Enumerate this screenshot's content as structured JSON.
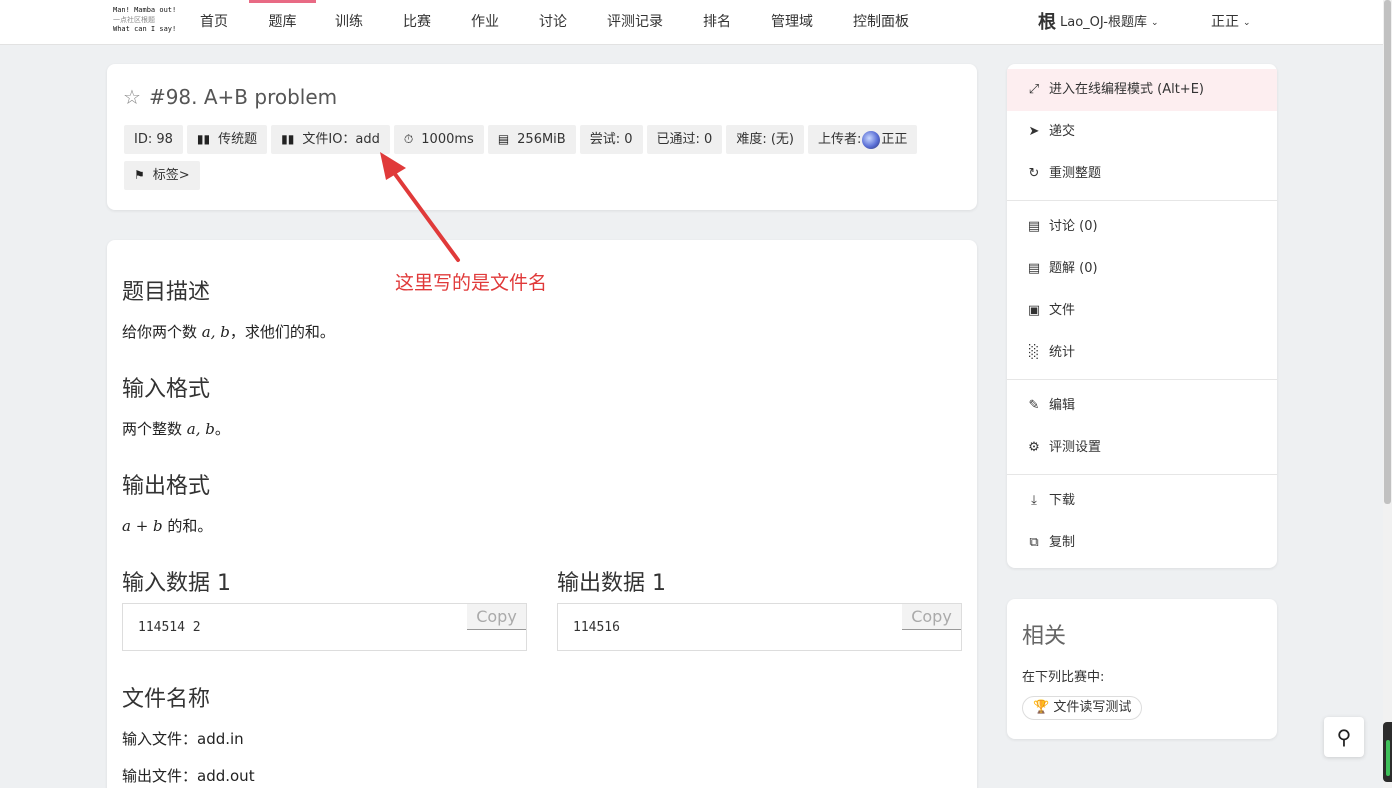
{
  "logo": {
    "line1": "Man! Mamba out!",
    "line2": "一点社区根题",
    "line3": "What can I say!"
  },
  "nav": [
    {
      "label": "首页",
      "active": false
    },
    {
      "label": "题库",
      "active": true
    },
    {
      "label": "训练",
      "active": false
    },
    {
      "label": "比赛",
      "active": false
    },
    {
      "label": "作业",
      "active": false
    },
    {
      "label": "讨论",
      "active": false
    },
    {
      "label": "评测记录",
      "active": false
    },
    {
      "label": "排名",
      "active": false
    },
    {
      "label": "管理域",
      "active": false
    },
    {
      "label": "控制面板",
      "active": false
    }
  ],
  "site_switch": {
    "glyph": "根",
    "label": "Lao_OJ-根题库"
  },
  "user": {
    "name": "正正"
  },
  "problem": {
    "title": "#98. A+B problem",
    "meta": {
      "id": "ID: 98",
      "type": "传统题",
      "file_io": "文件IO：add",
      "time_limit": "1000ms",
      "memory": "256MiB",
      "tried": "尝试: 0",
      "passed": "已通过: 0",
      "difficulty": "难度: (无)",
      "uploader_label": "上传者:",
      "uploader": "正正"
    },
    "tags_button": "标签>"
  },
  "annotation": "这里写的是文件名",
  "content": {
    "desc_title": "题目描述",
    "desc_pre": "给你两个数 ",
    "desc_math": "a, b",
    "desc_post": "，求他们的和。",
    "input_title": "输入格式",
    "input_pre": "两个整数 ",
    "input_math": "a, b",
    "input_post": "。",
    "output_title": "输出格式",
    "output_math": "a + b",
    "output_post": " 的和。",
    "sample_in_title": "输入数据 1",
    "sample_in": "114514 2",
    "sample_out_title": "输出数据 1",
    "sample_out": "114516",
    "copy_label": "Copy",
    "file_title": "文件名称",
    "input_file": "输入文件：add.in",
    "output_file": "输出文件：add.out"
  },
  "sidebar": {
    "items": [
      {
        "label": "进入在线编程模式 (Alt+E)",
        "icon": "expand-icon"
      },
      {
        "label": "递交",
        "icon": "send-icon"
      },
      {
        "label": "重测整题",
        "icon": "refresh-icon"
      },
      {
        "label": "讨论 (0)",
        "icon": "comment-icon"
      },
      {
        "label": "题解 (0)",
        "icon": "comment-icon"
      },
      {
        "label": "文件",
        "icon": "image-file-icon"
      },
      {
        "label": "统计",
        "icon": "bar-chart-icon"
      },
      {
        "label": "编辑",
        "icon": "pencil-icon"
      },
      {
        "label": "评测设置",
        "icon": "gear-icon"
      },
      {
        "label": "下载",
        "icon": "download-icon"
      },
      {
        "label": "复制",
        "icon": "copy-icon"
      }
    ]
  },
  "related": {
    "title": "相关",
    "subtitle": "在下列比赛中:",
    "contest": "文件读写测试"
  },
  "colors": {
    "accent": "#e86a84",
    "annotation": "#e03a3a"
  }
}
